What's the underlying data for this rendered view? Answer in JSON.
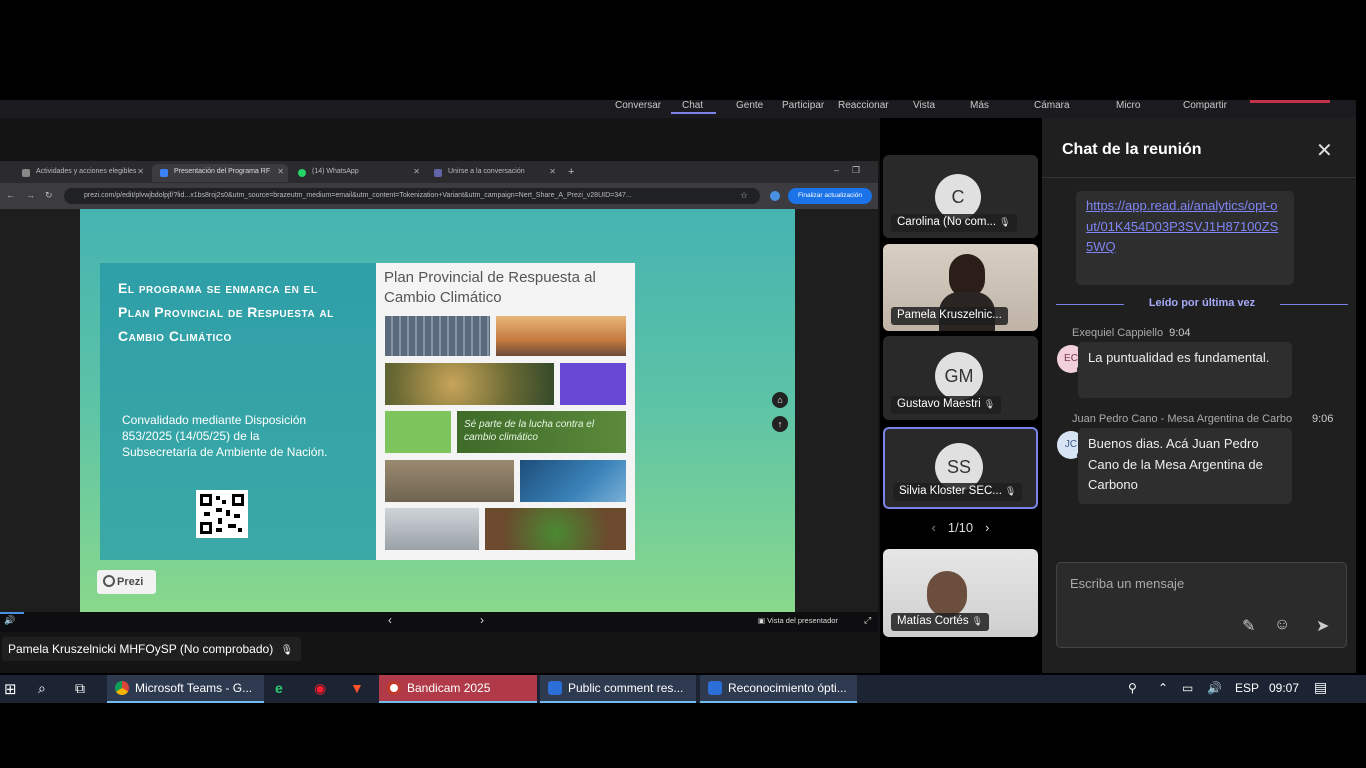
{
  "teams_toolbar": {
    "items": [
      "Conversar",
      "Chat",
      "Gente",
      "Participar",
      "Reaccionar",
      "Vista",
      "Más",
      "Cámara",
      "Micro",
      "Compartir"
    ]
  },
  "browser": {
    "tabs": [
      {
        "label": "Actividades y acciones elegibles"
      },
      {
        "label": "Presentación del Programa RF"
      },
      {
        "label": "(14) WhatsApp"
      },
      {
        "label": "Unirse a la conversación"
      }
    ],
    "new_tab": "+",
    "url": "prezi.com/p/edit/plvwjbdolpjf/?lid...x1bs8roj2s0&utm_source=brazeutm_medium=email&utm_content=Tokenization+Variant&utm_campaign=Nert_Share_A_Prezi_v28UID=347...",
    "update_button": "Finalizar actualización"
  },
  "slide": {
    "heading": "El programa se enmarca en el Plan Provincial de Respuesta al Cambio Climático",
    "subtext": "Convalidado mediante Disposición 853/2025 (14/05/25) de la Subsecretaría de Ambiente de Nación.",
    "plan_title": "Plan Provincial de Respuesta al Cambio Climático",
    "tagline": "Sé parte de la lucha contra el cambio climático",
    "prezi_label": "Prezi"
  },
  "presentation_bar": {
    "presenter_view": "Vista del presentador",
    "prev": "‹",
    "next": "›"
  },
  "presenter_name": "Pamela Kruszelnicki MHFOySP (No comprobado)",
  "participants": [
    {
      "initials": "C",
      "name": "Carolina (No com..."
    },
    {
      "initials": "",
      "name": "Pamela Kruszelnic..."
    },
    {
      "initials": "GM",
      "name": "Gustavo Maestri"
    },
    {
      "initials": "SS",
      "name": "Silvia Kloster SEC..."
    },
    {
      "initials": "",
      "name": "Matías Cortés"
    }
  ],
  "pager": "1/10",
  "chat": {
    "title": "Chat de la reunión",
    "link_text": "https://app.read.ai/analytics/opt-out/01K454D03P3SVJ1H87100ZS5WQ",
    "last_read": "Leído por última vez",
    "messages": [
      {
        "author": "Exequiel Cappiello",
        "time": "9:04",
        "initials": "EC",
        "text": "La puntualidad es fundamental."
      },
      {
        "author": "Juan Pedro Cano - Mesa Argentina de Carbo",
        "time": "9:06",
        "initials": "JC",
        "text": "Buenos dias. Acá Juan Pedro Cano de la Mesa Argentina de Carbono"
      }
    ],
    "compose_placeholder": "Escriba un mensaje"
  },
  "taskbar": {
    "buttons": [
      {
        "label": "Microsoft Teams - G..."
      },
      {
        "label": "Bandicam 2025"
      },
      {
        "label": "Public comment res..."
      },
      {
        "label": "Reconocimiento ópti..."
      }
    ],
    "language": "ESP",
    "clock": "09:07"
  },
  "colors": {
    "accent": "#7b83eb",
    "link": "#7f85f5",
    "slide_teal": "#45b3b1",
    "slide_green": "#89d88b"
  }
}
